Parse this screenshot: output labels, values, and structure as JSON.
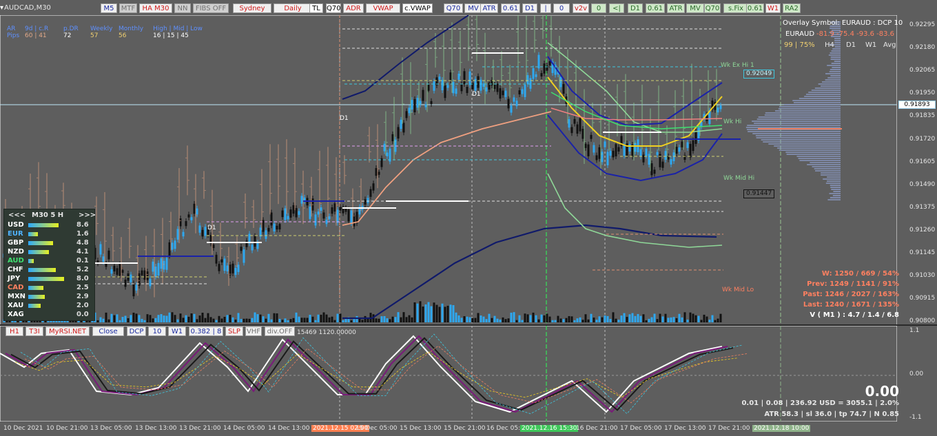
{
  "symbol": "AUDCAD,M30",
  "toolbar": [
    {
      "label": "M5",
      "style": "blue"
    },
    {
      "label": "MTF",
      "style": "dim"
    },
    {
      "label": "HA M30",
      "style": "red"
    },
    {
      "label": "NN",
      "style": "dim"
    },
    {
      "label": "FIBS OFF",
      "style": "dim"
    },
    {
      "label": "Sydney",
      "style": "red"
    },
    {
      "label": "Daily",
      "style": "red"
    },
    {
      "label": "TL",
      "style": "on"
    },
    {
      "label": "Q70",
      "style": "on"
    },
    {
      "label": "ADR",
      "style": "red"
    },
    {
      "label": "VWAP",
      "style": "red"
    },
    {
      "label": "c.VWAP",
      "style": "on"
    },
    {
      "label": "Q70",
      "style": "blue"
    },
    {
      "label": "MV",
      "style": "blue"
    },
    {
      "label": "ATR",
      "style": "blue"
    },
    {
      "label": "0.61",
      "style": "blue"
    },
    {
      "label": "D1",
      "style": "blue"
    },
    {
      "label": "|",
      "style": "blue"
    },
    {
      "label": "0",
      "style": "blue"
    },
    {
      "label": "v2v",
      "style": "red"
    },
    {
      "label": "0",
      "style": "green"
    },
    {
      "label": "<|",
      "style": "green"
    },
    {
      "label": "D1",
      "style": "green"
    },
    {
      "label": "0.61",
      "style": "green"
    },
    {
      "label": "ATR",
      "style": "green"
    },
    {
      "label": "MV",
      "style": "green"
    },
    {
      "label": "Q70",
      "style": "green"
    },
    {
      "label": "s.Fix",
      "style": "green"
    },
    {
      "label": "0.61",
      "style": "green"
    },
    {
      "label": "W1",
      "style": "red"
    },
    {
      "label": "RA2",
      "style": "green"
    }
  ],
  "stats_header": {
    "labels": [
      "AR",
      "9d | c.R",
      "p.DR",
      "Weekly",
      "Monthly",
      "High | Mid | Low"
    ],
    "row_label": "Pips",
    "values": [
      "60 | 41",
      "72",
      "57",
      "56",
      "16 | 15 | 45"
    ]
  },
  "overlay": {
    "line1": "Overlay Symbol: EURAUD : DCP 10",
    "symbol": "EURAUD",
    "values": "-81.9  -75.4  -93.6  -83.6",
    "pct": "99 | 75%",
    "tfs": [
      "H4",
      "D1",
      "W1",
      "Avg"
    ]
  },
  "price_axis": [
    "0.92295",
    "0.92180",
    "0.92065",
    "0.91950",
    "0.91835",
    "0.91720",
    "0.91605",
    "0.91490",
    "0.91375",
    "0.91260",
    "0.91145",
    "0.91030",
    "0.90915",
    "0.90800"
  ],
  "price_current": "0.91893",
  "price_tags": {
    "upper": "0.92049",
    "lower": "0.91447"
  },
  "chart_labels": {
    "wk_ex_hi": "Wk Ex Hi 1",
    "wk_hi": "Wk Hi",
    "wk_mid_hi": "Wk Mid Hi",
    "wk_mid_lo": "Wk Mid Lo",
    "d1": "D1"
  },
  "panel": {
    "header_left": "<<<",
    "header_mid": "M30  5  H",
    "header_right": ">>>",
    "rows": [
      {
        "sym": "USD",
        "val": "8.6",
        "color": "#ffffff"
      },
      {
        "sym": "EUR",
        "val": "1.6",
        "color": "#4fb3ff"
      },
      {
        "sym": "GBP",
        "val": "4.8",
        "color": "#ffffff"
      },
      {
        "sym": "NZD",
        "val": "4.1",
        "color": "#ffffff"
      },
      {
        "sym": "AUD",
        "val": "0.1",
        "color": "#3ee070"
      },
      {
        "sym": "CHF",
        "val": "5.2",
        "color": "#ffffff"
      },
      {
        "sym": "JPY",
        "val": "8.0",
        "color": "#ffffff"
      },
      {
        "sym": "CAD",
        "val": "2.5",
        "color": "#ff8060"
      },
      {
        "sym": "MXN",
        "val": "2.9",
        "color": "#ffffff"
      },
      {
        "sym": "XAU",
        "val": "2.0",
        "color": "#ffffff"
      },
      {
        "sym": "XAG",
        "val": "0.0",
        "color": "#ffffff"
      }
    ]
  },
  "right_stats": {
    "w": "W: 1250 / 669 / 54%",
    "prev": "Prev: 1249 / 1141 / 91%",
    "past": "Past: 1246 / 2027 / 163%",
    "last": "Last: 1240 / 1671 / 135%",
    "v": "V ( M1 ) : 4.7 / 1.4 / 6.8"
  },
  "subwindow_bar": [
    {
      "label": "H1",
      "style": "red"
    },
    {
      "label": "T3I",
      "style": "red"
    },
    {
      "label": "MyRSI.NET",
      "style": "red"
    },
    {
      "label": "Close",
      "style": "blue"
    },
    {
      "label": "DCP",
      "style": "blue"
    },
    {
      "label": "10",
      "style": "blue"
    },
    {
      "label": "W1",
      "style": "blue"
    },
    {
      "label": "0.382 | 8",
      "style": "blue"
    },
    {
      "label": "SLP",
      "style": "red"
    },
    {
      "label": "VHF",
      "style": "dim"
    },
    {
      "label": "div.OFF",
      "style": "dim"
    }
  ],
  "subwindow_text": "15469 1120.00000",
  "sub_axis": [
    "1.1",
    "0.00",
    "-1.1"
  ],
  "sub_value": "0.00",
  "sub_stats": {
    "line1": "0.01  |  0.08  |  236.92 USD = 3055.1  |  2.0%",
    "line2": "ATR 58.3  | sl 36.0  |  tp 74.7  |  N 0.85"
  },
  "dates": [
    "10 Dec 2021",
    "10 Dec 21:00",
    "13 Dec 05:00",
    "13 Dec 13:00",
    "13 Dec 21:00",
    "14 Dec 05:00",
    "14 Dec 13:00",
    "2021.12.15 02:00",
    "15 Dec 05:00",
    "15 Dec 13:00",
    "15 Dec 21:00",
    "16 Dec 05:",
    "2021.12.16 15:30",
    "16 Dec 21:00",
    "17 Dec 05:00",
    "17 Dec 13:00",
    "17 Dec 21:00",
    "2021.12.18 10:00"
  ]
}
